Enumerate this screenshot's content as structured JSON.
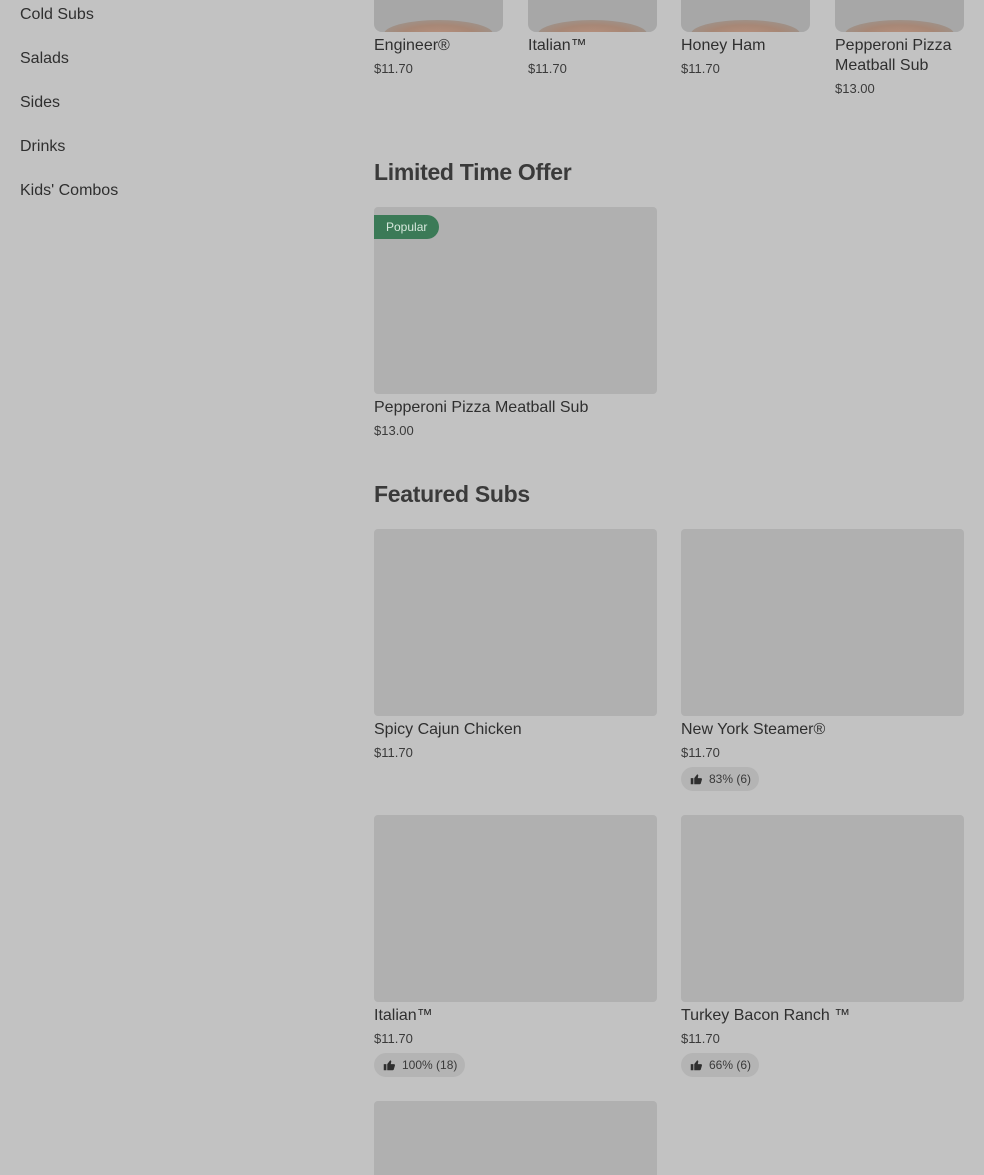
{
  "sidebar": {
    "items": [
      {
        "label": "Cold Subs"
      },
      {
        "label": "Salads"
      },
      {
        "label": "Sides"
      },
      {
        "label": "Drinks"
      },
      {
        "label": "Kids' Combos"
      }
    ]
  },
  "carousel": {
    "items": [
      {
        "title": "Engineer®",
        "price": "$11.70"
      },
      {
        "title": "Italian™",
        "price": "$11.70"
      },
      {
        "title": "Honey Ham",
        "price": "$11.70"
      },
      {
        "title_line1": "Pepperoni Pizza",
        "title_line2": "Meatball Sub",
        "price": "$13.00"
      }
    ]
  },
  "limited_offer": {
    "heading": "Limited Time Offer",
    "items": [
      {
        "badge": "Popular",
        "title": "Pepperoni Pizza Meatball Sub",
        "price": "$13.00"
      }
    ]
  },
  "featured": {
    "heading": "Featured Subs",
    "items": [
      {
        "title": "Spicy Cajun Chicken",
        "price": "$11.70",
        "rating": ""
      },
      {
        "title": "New York Steamer®",
        "price": "$11.70",
        "rating": "83% (6)"
      },
      {
        "title": "Italian™",
        "price": "$11.70",
        "rating": "100% (18)"
      },
      {
        "title": "Turkey Bacon Ranch ™",
        "price": "$11.70",
        "rating": "66% (6)"
      }
    ]
  },
  "icons": {
    "rating": "thumbs-up-icon"
  }
}
